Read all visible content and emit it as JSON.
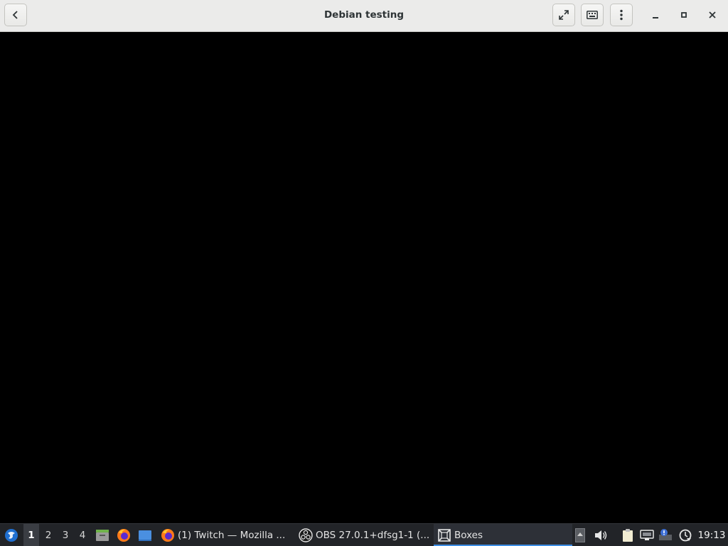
{
  "window": {
    "title": "Debian testing",
    "back_icon": "chevron-left-icon",
    "buttons": [
      "fullscreen-icon",
      "keyboard-icon",
      "menu-dots-icon"
    ],
    "controls": [
      "minimize-icon",
      "maximize-icon",
      "close-icon"
    ]
  },
  "taskbar": {
    "workspaces": [
      "1",
      "2",
      "3",
      "4"
    ],
    "active_workspace": "1",
    "launchers": [
      "file-manager-icon",
      "firefox-icon",
      "desktop-icon"
    ],
    "tasks": [
      {
        "icon": "firefox-icon",
        "label": "(1) Twitch — Mozilla ..."
      },
      {
        "icon": "obs-icon",
        "label": "OBS 27.0.1+dfsg1-1 (..."
      },
      {
        "icon": "boxes-icon",
        "label": "Boxes"
      }
    ],
    "tray": [
      "tray-up-icon",
      "volume-icon",
      "clipboard-icon",
      "network-icon",
      "notification-icon",
      "update-icon"
    ],
    "clock": "19:13",
    "accent": "#3d8ee6"
  }
}
